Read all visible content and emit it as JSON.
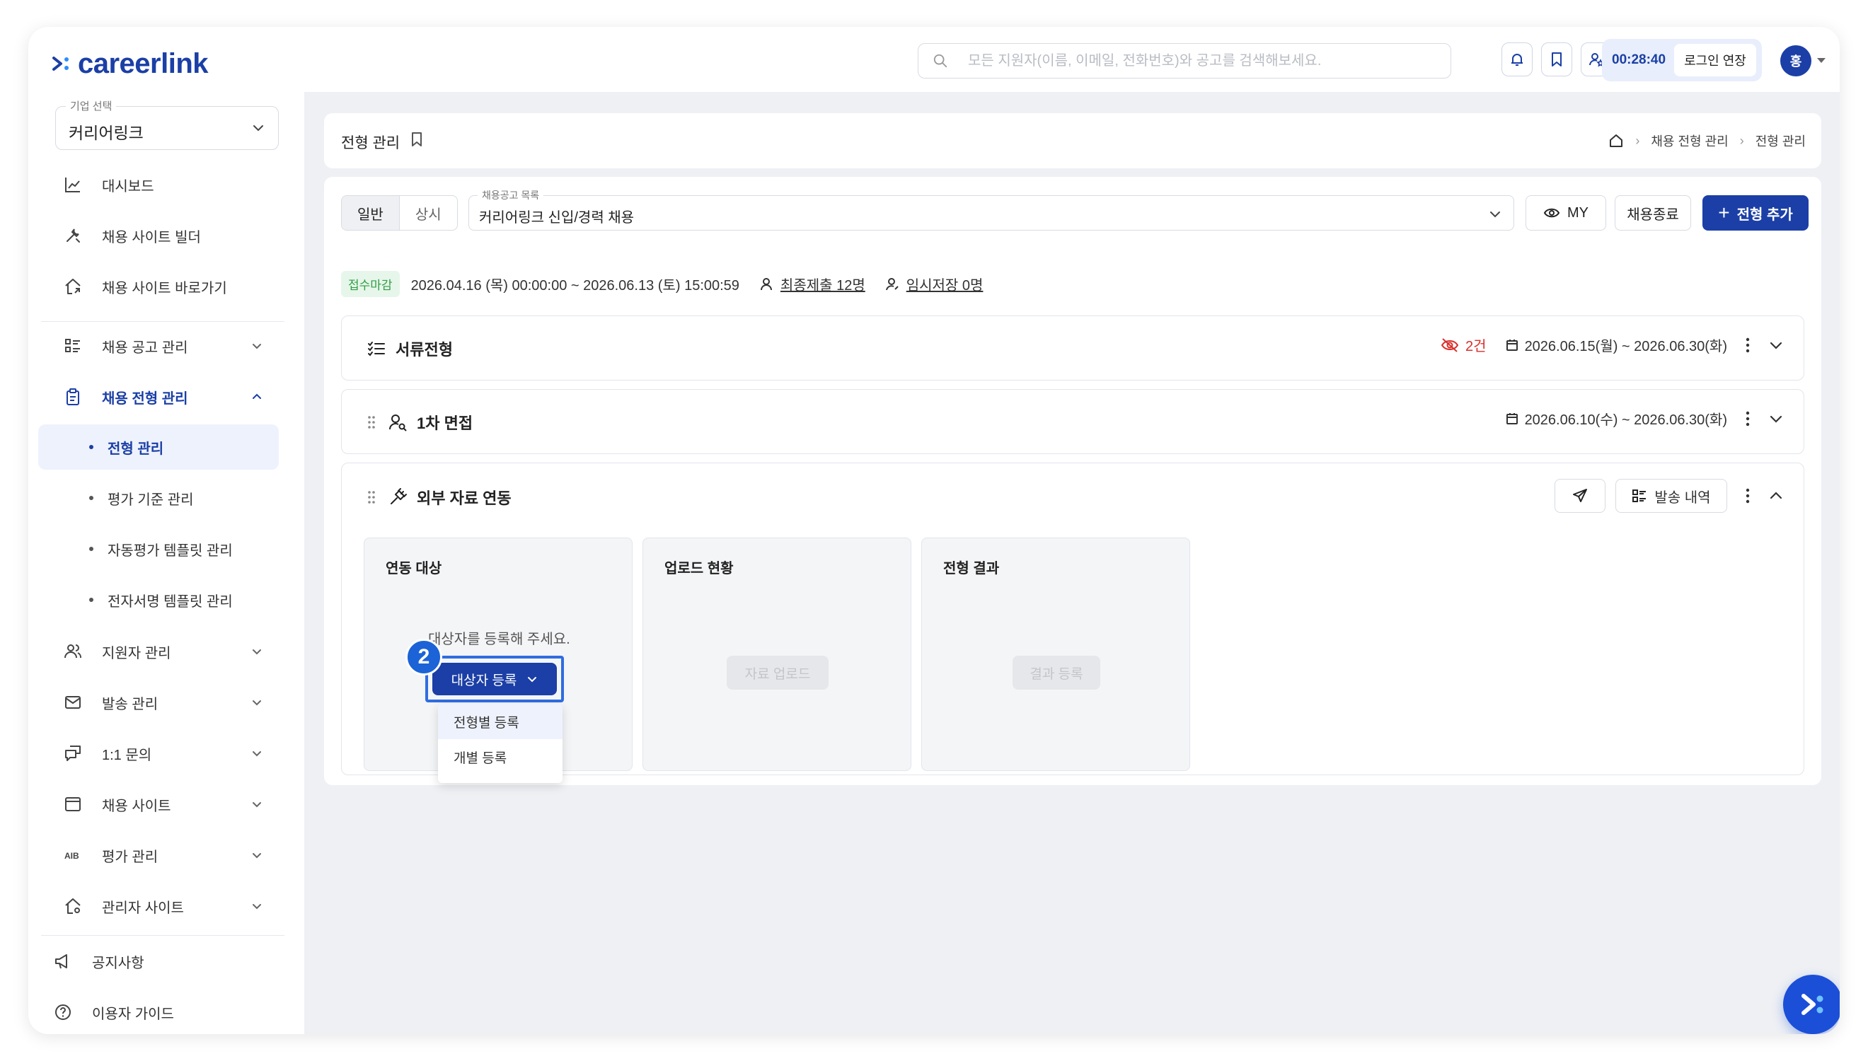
{
  "brand": {
    "name": "careerlink",
    "color": "#1b3fa6"
  },
  "header": {
    "search_placeholder": "모든 지원자(이름, 이메일, 전화번호)와 공고를 검색해보세요.",
    "icons": [
      "bell-icon",
      "bookmark-icon",
      "user-star-icon"
    ],
    "session_timer": "00:28:40",
    "extend_login": "로그인 연장",
    "avatar_initial": "홍"
  },
  "sidebar": {
    "company_legend": "기업 선택",
    "company_value": "커리어링크",
    "items": [
      {
        "label": "대시보드",
        "icon": "chart-icon"
      },
      {
        "label": "채용 사이트 빌더",
        "icon": "tools-icon"
      },
      {
        "label": "채용 사이트 바로가기",
        "icon": "home-link-icon"
      },
      {
        "label": "채용 공고 관리",
        "icon": "list-icon"
      },
      {
        "label": "채용 전형 관리",
        "icon": "clipboard-icon"
      },
      {
        "label": "지원자 관리",
        "icon": "users-icon"
      },
      {
        "label": "발송 관리",
        "icon": "mail-icon"
      },
      {
        "label": "1:1 문의",
        "icon": "chat-icon"
      },
      {
        "label": "채용 사이트",
        "icon": "browser-icon"
      },
      {
        "label": "평가 관리",
        "icon": "ab-icon"
      },
      {
        "label": "관리자 사이트",
        "icon": "admin-home-icon"
      }
    ],
    "sub_items": [
      "전형 관리",
      "평가 기준 관리",
      "자동평가 템플릿 관리",
      "전자서명 템플릿 관리"
    ],
    "bottom": [
      "공지사항",
      "이용자 가이드"
    ]
  },
  "breadcrumb": {
    "title": "전형 관리",
    "path": [
      "채용 전형 관리",
      "전형 관리"
    ]
  },
  "toolbar": {
    "tabs": [
      "일반",
      "상시"
    ],
    "posting_legend": "채용공고 목록",
    "posting_value": "커리어링크 신입/경력 채용",
    "my_label": "MY",
    "close_label": "채용종료",
    "add_label": "전형 추가"
  },
  "meta": {
    "status": "접수마감",
    "period": "2026.04.16 (목) 00:00:00 ~ 2026.06.13 (토) 15:00:59",
    "final_submit": "최종제출 12명",
    "temp_saved": "임시저장 0명"
  },
  "stages": [
    {
      "title": "서류전형",
      "hidden_count": "2건",
      "dates": "2026.06.15(월) ~ 2026.06.30(화)"
    },
    {
      "title": "1차 면접",
      "dates": "2026.06.10(수) ~ 2026.06.30(화)"
    },
    {
      "title": "외부 자료 연동",
      "history_label": "발송 내역"
    }
  ],
  "panels": {
    "target": {
      "title": "연동 대상",
      "empty": "대상자를 등록해 주세요.",
      "button": "대상자 등록",
      "options": [
        "전형별 등록",
        "개별 등록"
      ]
    },
    "upload": {
      "title": "업로드 현황",
      "button": "자료 업로드"
    },
    "result": {
      "title": "전형 결과",
      "button": "결과 등록"
    }
  },
  "annotation": {
    "step": "2"
  }
}
